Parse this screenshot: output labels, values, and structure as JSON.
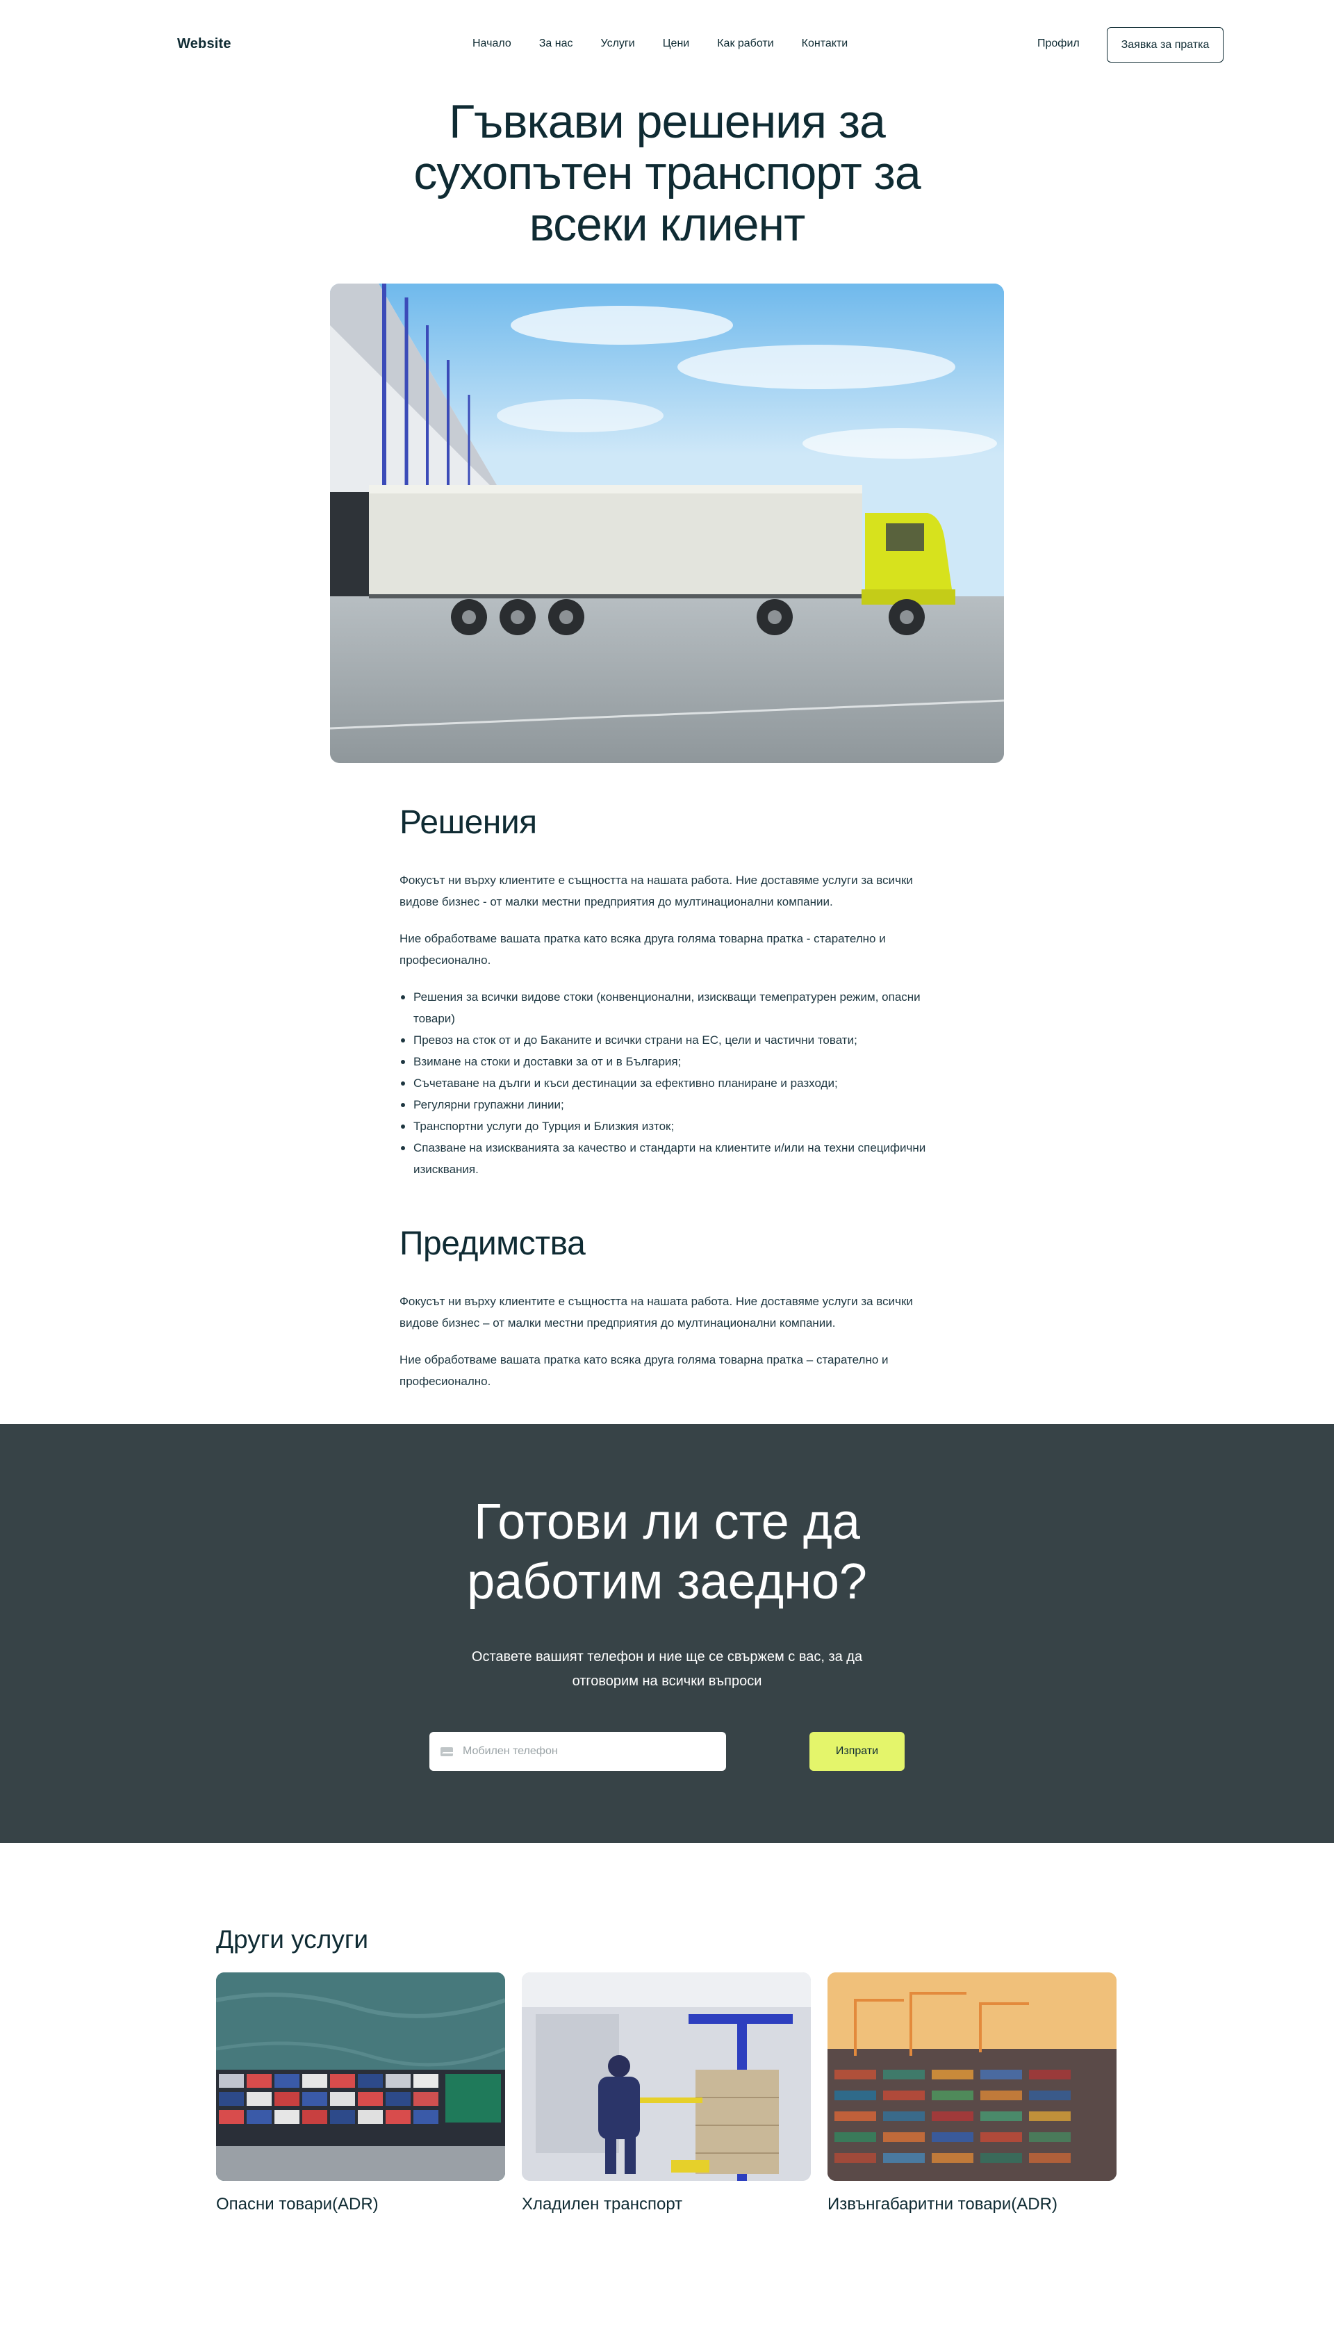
{
  "header": {
    "logo": "Website",
    "nav": [
      "Начало",
      "За нас",
      "Услуги",
      "Цени",
      "Как работи",
      "Контакти"
    ],
    "profile": "Профил",
    "cta": "Заявка за пратка"
  },
  "hero": {
    "title": "Гъвкави решения за сухопътен транспорт за всеки клиент"
  },
  "solutions": {
    "title": "Решения",
    "paragraphs": [
      "Фокусът ни върху клиентите е същността на нашата работа. Ние доставяме услуги за всички видове бизнес - от малки местни предприятия до мултинационални компании.",
      "Ние обработваме вашата пратка като всяка друга голяма товарна пратка - старателно и професионално."
    ],
    "bullets": [
      "Решения за всички видове стоки (конвенционални, изискващи темепратурен режим, опасни товари)",
      "Превоз на сток от и до Баканите и всички страни на ЕС, цели и частични товати;",
      "Взимане на стоки и доставки за от и в България;",
      "Съчетаване на дълги и къси дестинации за ефективно планиране и разходи;",
      "Регулярни групажни линии;",
      "Транспортни услуги до Турция и Близкия изток;",
      "Спазване на изискванията за качество и стандарти на клиентите и/или на техни специфични изисквания."
    ]
  },
  "advantages": {
    "title": "Предимства",
    "paragraphs": [
      "Фокусът ни върху клиентите е същността на нашата работа. Ние доставяме услуги за всички видове бизнес – от малки местни предприятия до мултинационални компании.",
      "Ние обработваме вашата пратка като всяка друга голяма товарна пратка – старателно и професионално."
    ]
  },
  "cta_band": {
    "title": "Готови ли сте да работим заедно?",
    "subtitle": "Оставете вашият телефон и ние ще се свържем с вас, за да отговорим на всички въпроси",
    "phone_placeholder": "Мобилен телефон",
    "phone_value": "",
    "send": "Изпрати",
    "bg_color": "#374347",
    "button_color": "#e4f56b"
  },
  "other_services": {
    "title": "Други услуги",
    "cards": [
      {
        "label": "Опасни товари(ADR)",
        "image": "cargo-ship-image"
      },
      {
        "label": "Хладилен транспорт",
        "image": "cold-storage-image"
      },
      {
        "label": "Извънгабаритни товари(ADR)",
        "image": "container-port-image"
      }
    ]
  }
}
